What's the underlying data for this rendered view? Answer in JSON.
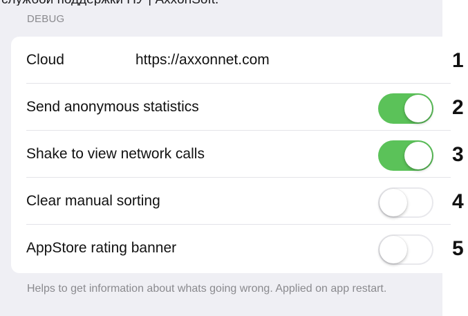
{
  "top_crop_text": "службой поддержки ПУ | AxxonSoft.",
  "section": {
    "header": "DEBUG",
    "footer": "Helps to get information about whats going wrong. Applied on app restart."
  },
  "rows": [
    {
      "label": "Cloud",
      "value": "https://axxonnet.com",
      "marker": "1"
    },
    {
      "label": "Send anonymous statistics",
      "toggle_on": true,
      "marker": "2"
    },
    {
      "label": "Shake to view network calls",
      "toggle_on": true,
      "marker": "3"
    },
    {
      "label": "Clear manual sorting",
      "toggle_on": false,
      "marker": "4"
    },
    {
      "label": "AppStore rating banner",
      "toggle_on": false,
      "marker": "5"
    }
  ],
  "colors": {
    "toggle_on": "#5bc259",
    "background": "#efeff4",
    "card": "#ffffff"
  }
}
